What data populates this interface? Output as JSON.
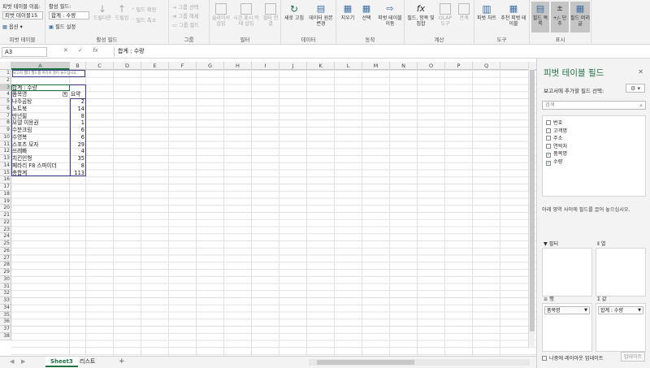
{
  "ribbon": {
    "pivot_name_label": "피벗 테이블 이름:",
    "pivot_name_value": "피벗 테이블15",
    "options_label": "옵션",
    "group_pivot_table": "피벗 테이블",
    "active_field_label": "활성 필드:",
    "active_field_value": "합계 : 수량",
    "field_settings": "필드 설정",
    "drill_down": "드릴다운",
    "drill_up": "드릴업",
    "expand_field": "필드 확장",
    "collapse_field": "필드 축소",
    "group_active_field": "활성 필드",
    "group_selection": "그룹 선택",
    "ungroup": "그룹 해제",
    "group_field": "그룹 필드",
    "group_group": "그룹",
    "insert_slicer": "슬라이서 삽입",
    "insert_timeline": "시간 표시 막대 삽입",
    "filter_connections": "필터 연결",
    "group_filter": "필터",
    "refresh": "새로 고침",
    "change_data_source": "데이터 원본 변경",
    "group_data": "데이터",
    "clear": "지우기",
    "select": "선택",
    "move_pivot": "피벗 테이블 이동",
    "group_actions": "동작",
    "fields_items_sets": "필드, 항목 및 집합",
    "olap_tools": "OLAP 도구",
    "relationships": "관계",
    "group_calculations": "계산",
    "pivot_chart": "피벗 차트",
    "recommended_pivot": "추천 피벗 테이블",
    "group_tools": "도구",
    "field_list": "필드 목록",
    "buttons": "+/- 단추",
    "field_headers": "필드 머리글",
    "group_show": "표시"
  },
  "formula_bar": {
    "name_box": "A3",
    "cancel": "✕",
    "enter": "✓",
    "fx": "fx",
    "formula": "합계 : 수량"
  },
  "grid": {
    "columns": [
      "A",
      "B",
      "C",
      "D",
      "E",
      "F",
      "G",
      "H",
      "I",
      "J",
      "K",
      "L",
      "M",
      "N",
      "O",
      "P",
      "Q"
    ],
    "rows": [
      "1",
      "2",
      "3",
      "4",
      "5",
      "6",
      "7",
      "8",
      "9",
      "10",
      "11",
      "12",
      "13",
      "14",
      "15",
      "16",
      "17",
      "18",
      "19",
      "20",
      "21",
      "22",
      "23",
      "24",
      "25",
      "26",
      "27",
      "28",
      "29",
      "30",
      "31",
      "32",
      "33",
      "34",
      "35",
      "36",
      "37",
      "38"
    ],
    "report_filter_hint": "보고서 필터 필드를 여기로 끌어 놓으십시오.",
    "pivot_title": "합계 : 수량",
    "col_header_1": "품목명",
    "col_header_2": "요약",
    "items": [
      {
        "name": "나주곰탕",
        "value": "2"
      },
      {
        "name": "노트북",
        "value": "14"
      },
      {
        "name": "만년필",
        "value": "8"
      },
      {
        "name": "모델 이용권",
        "value": "1"
      },
      {
        "name": "수분크림",
        "value": "6"
      },
      {
        "name": "수영복",
        "value": "6"
      },
      {
        "name": "스포츠 모자",
        "value": "29"
      },
      {
        "name": "쓰레빠",
        "value": "4"
      },
      {
        "name": "치킨인형",
        "value": "35"
      },
      {
        "name": "페라리 F8 스파이더",
        "value": "8"
      }
    ],
    "total_label": "총합계",
    "total_value": "113"
  },
  "sheet_tabs": {
    "tabs": [
      "Sheet3",
      "리스트"
    ],
    "active": "Sheet3",
    "add": "+"
  },
  "pane": {
    "title": "피벗 테이블 필드",
    "subtitle": "보고서에 추가할 필드 선택:",
    "gear": "⚙ ▾",
    "search_placeholder": "검색",
    "fields": [
      {
        "label": "번호",
        "checked": false
      },
      {
        "label": "고객명",
        "checked": false
      },
      {
        "label": "주소",
        "checked": false
      },
      {
        "label": "연락처",
        "checked": false
      },
      {
        "label": "품목명",
        "checked": true
      },
      {
        "label": "수량",
        "checked": true
      }
    ],
    "drag_hint": "아래 영역 사이에 필드를 끌어 놓으십시오.",
    "zone_filter": "필터",
    "zone_columns": "열",
    "zone_rows": "행",
    "zone_values": "값",
    "rows_item": "품목명",
    "values_item": "합계 : 수량",
    "defer_label": "나중에 레이아웃 업데이트",
    "update_button": "업데이트"
  },
  "colors": {
    "excel_green": "#217346",
    "pivot_border": "#3b3b8f"
  }
}
